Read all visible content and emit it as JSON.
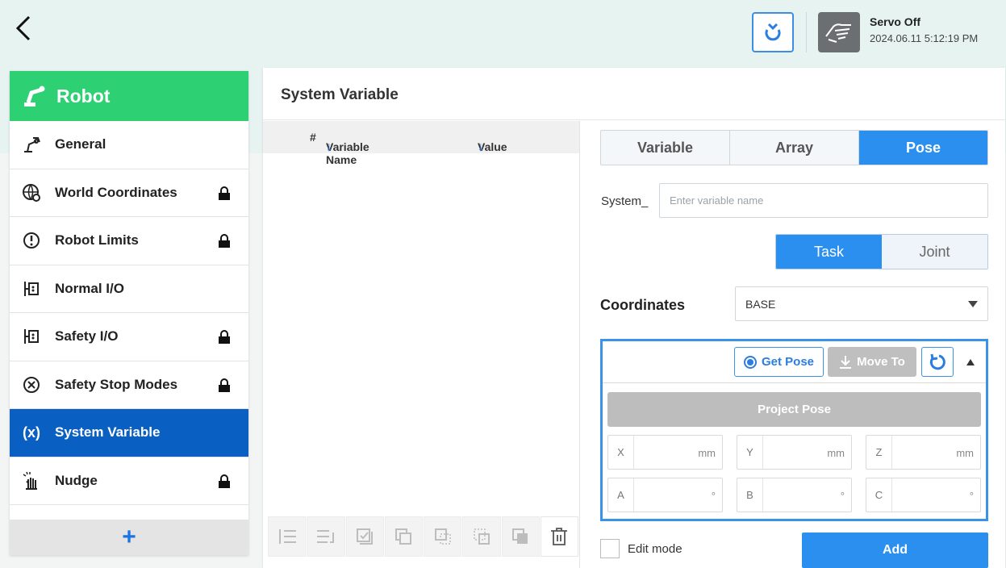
{
  "header": {
    "servo_status": "Servo Off",
    "datetime": "2024.06.11 5:12:19 PM"
  },
  "sidebar": {
    "title": "Robot",
    "items": [
      {
        "label": "General",
        "icon": "robot-arm-icon",
        "locked": false,
        "active": false
      },
      {
        "label": "World Coordinates",
        "icon": "globe-gear-icon",
        "locked": true,
        "active": false
      },
      {
        "label": "Robot Limits",
        "icon": "limit-circle-icon",
        "locked": true,
        "active": false
      },
      {
        "label": "Normal I/O",
        "icon": "io-port-icon",
        "locked": false,
        "active": false
      },
      {
        "label": "Safety I/O",
        "icon": "io-port-icon",
        "locked": true,
        "active": false
      },
      {
        "label": "Safety Stop Modes",
        "icon": "circle-x-icon",
        "locked": true,
        "active": false
      },
      {
        "label": "System Variable",
        "icon": "variable-x-icon",
        "locked": false,
        "active": true
      },
      {
        "label": "Nudge",
        "icon": "hand-tap-icon",
        "locked": true,
        "active": false
      }
    ],
    "add_label": "+"
  },
  "main": {
    "title": "System Variable",
    "table": {
      "columns": [
        "#",
        "Variable Name",
        "Value"
      ]
    },
    "type_tabs": [
      "Variable",
      "Array",
      "Pose"
    ],
    "active_type": "Pose",
    "name_prefix": "System_",
    "name_placeholder": "Enter variable name",
    "space_tabs": [
      "Task",
      "Joint"
    ],
    "active_space": "Task",
    "coordinates_label": "Coordinates",
    "coordinates_value": "BASE",
    "pose": {
      "get_pose": "Get Pose",
      "move_to": "Move To",
      "project_pose": "Project Pose",
      "fields": [
        {
          "label": "X",
          "unit": "mm"
        },
        {
          "label": "Y",
          "unit": "mm"
        },
        {
          "label": "Z",
          "unit": "mm"
        },
        {
          "label": "A",
          "unit": "°"
        },
        {
          "label": "B",
          "unit": "°"
        },
        {
          "label": "C",
          "unit": "°"
        }
      ]
    },
    "edit_mode": "Edit mode",
    "add": "Add"
  },
  "colors": {
    "accent_blue": "#2b8ff0",
    "sidebar_active": "#0a5fc3",
    "sidebar_header": "#2ed074"
  }
}
